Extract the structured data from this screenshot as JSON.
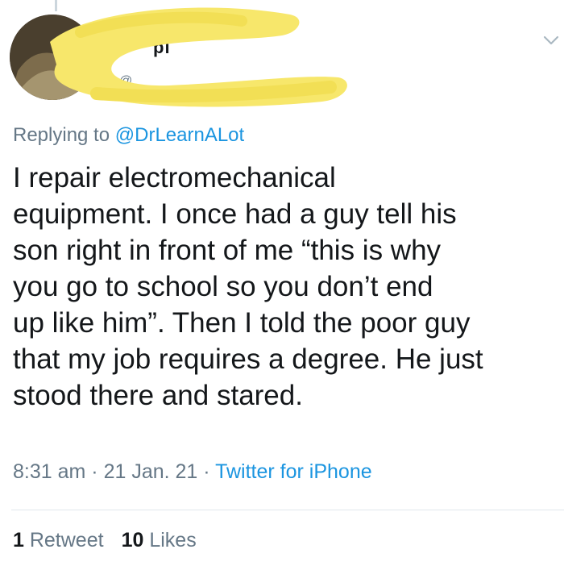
{
  "author": {
    "name_fragment": "pi",
    "handle_fragment": "@"
  },
  "reply": {
    "prefix": "Replying to ",
    "mention": "@DrLearnALot"
  },
  "tweet": {
    "text": "I repair electromechanical\nequipment.  I once had a guy tell his\nson right in front of me “this is why\nyou go to school so you don’t end\nup like him”. Then I told the poor guy\nthat my job requires a degree. He just\nstood there and stared."
  },
  "meta": {
    "time": "8:31 am",
    "separator1": " · ",
    "date": "21 Jan. 21",
    "separator2": " · ",
    "source": "Twitter for iPhone"
  },
  "stats": {
    "retweet_count": "1",
    "retweet_label": " Retweet",
    "like_count": "10",
    "like_label": " Likes"
  },
  "icons": {
    "menu": "chevron-down-icon"
  },
  "colors": {
    "link": "#1b95e0",
    "secondary": "#657786",
    "text": "#14171a",
    "redaction": "#f7e76b"
  }
}
